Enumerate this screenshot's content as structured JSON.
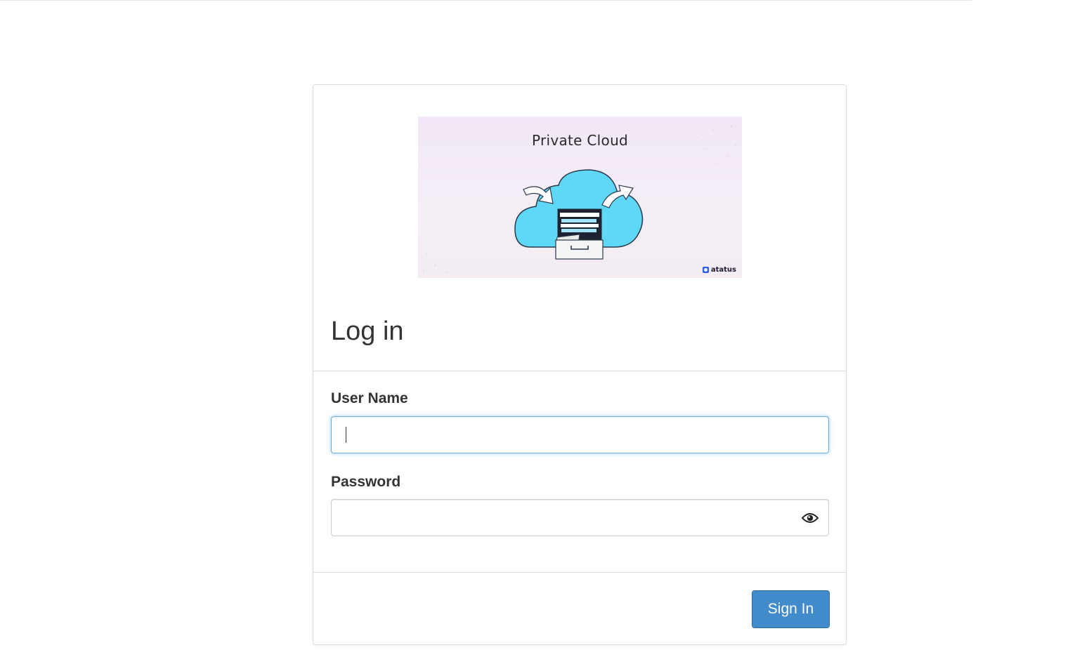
{
  "banner": {
    "title": "Private Cloud",
    "brand": "atatus"
  },
  "login": {
    "heading": "Log in",
    "username_label": "User Name",
    "username_value": "",
    "password_label": "Password",
    "password_value": "",
    "submit_label": "Sign In"
  },
  "icons": {
    "password_toggle": "eye-icon",
    "banner_art": "cloud-file-cabinet-icon"
  },
  "colors": {
    "primary_button": "#428bca",
    "focus_border": "#66afe9",
    "cloud": "#5fd7f7"
  }
}
